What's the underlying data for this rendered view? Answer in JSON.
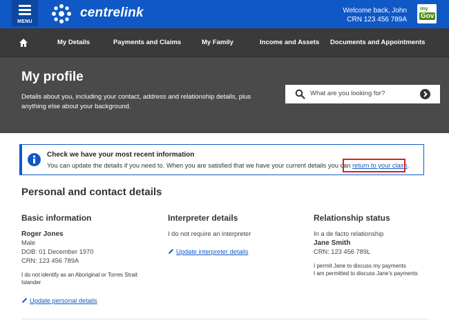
{
  "header": {
    "menu_label": "MENU",
    "brand": "centrelink",
    "welcome": "Welcome back, John",
    "crn": "CRN 123 456 789A",
    "mygov_my": "my",
    "mygov_gov": "Gov",
    "colors": {
      "header": "#1158c7",
      "nav": "#3a3a3a",
      "hero": "#4a4a4a"
    }
  },
  "nav": {
    "home_icon": "home-icon",
    "items": [
      "My Details",
      "Payments and Claims",
      "My Family",
      "Income and Assets",
      "Documents and Appointments"
    ]
  },
  "hero": {
    "title": "My profile",
    "description": "Details about you, including your contact, address and relationship details, plus anything else about your background.",
    "search_placeholder": "What are you looking for?"
  },
  "alert": {
    "title": "Check we have your most recent information",
    "message": "You can update the details if you need to. When you are satisfied that we have your current details you can ",
    "link": "return to your claim",
    "suffix": "."
  },
  "section": {
    "title": "Personal and contact details",
    "basic": {
      "heading": "Basic information",
      "name": "Roger Jones",
      "gender": "Male",
      "dob": "DOB: 01 December 1970",
      "crn": "CRN: 123 456 789A",
      "indigenous": "I do not identify as an Aboriginal or Torres Strait Islander",
      "update_link": "Update personal details"
    },
    "interpreter": {
      "heading": "Interpreter details",
      "status": "I do not require an interpreter",
      "update_link": "Update interpreter details"
    },
    "relationship": {
      "heading": "Relationship status",
      "status": "In a de facto relationship",
      "partner": "Jane Smith",
      "partner_crn": "CRN: 123 456 789L",
      "permission1": "I permit Jane to discuss my payments",
      "permission2": "I am permitted to discuss Jane's payments"
    }
  }
}
